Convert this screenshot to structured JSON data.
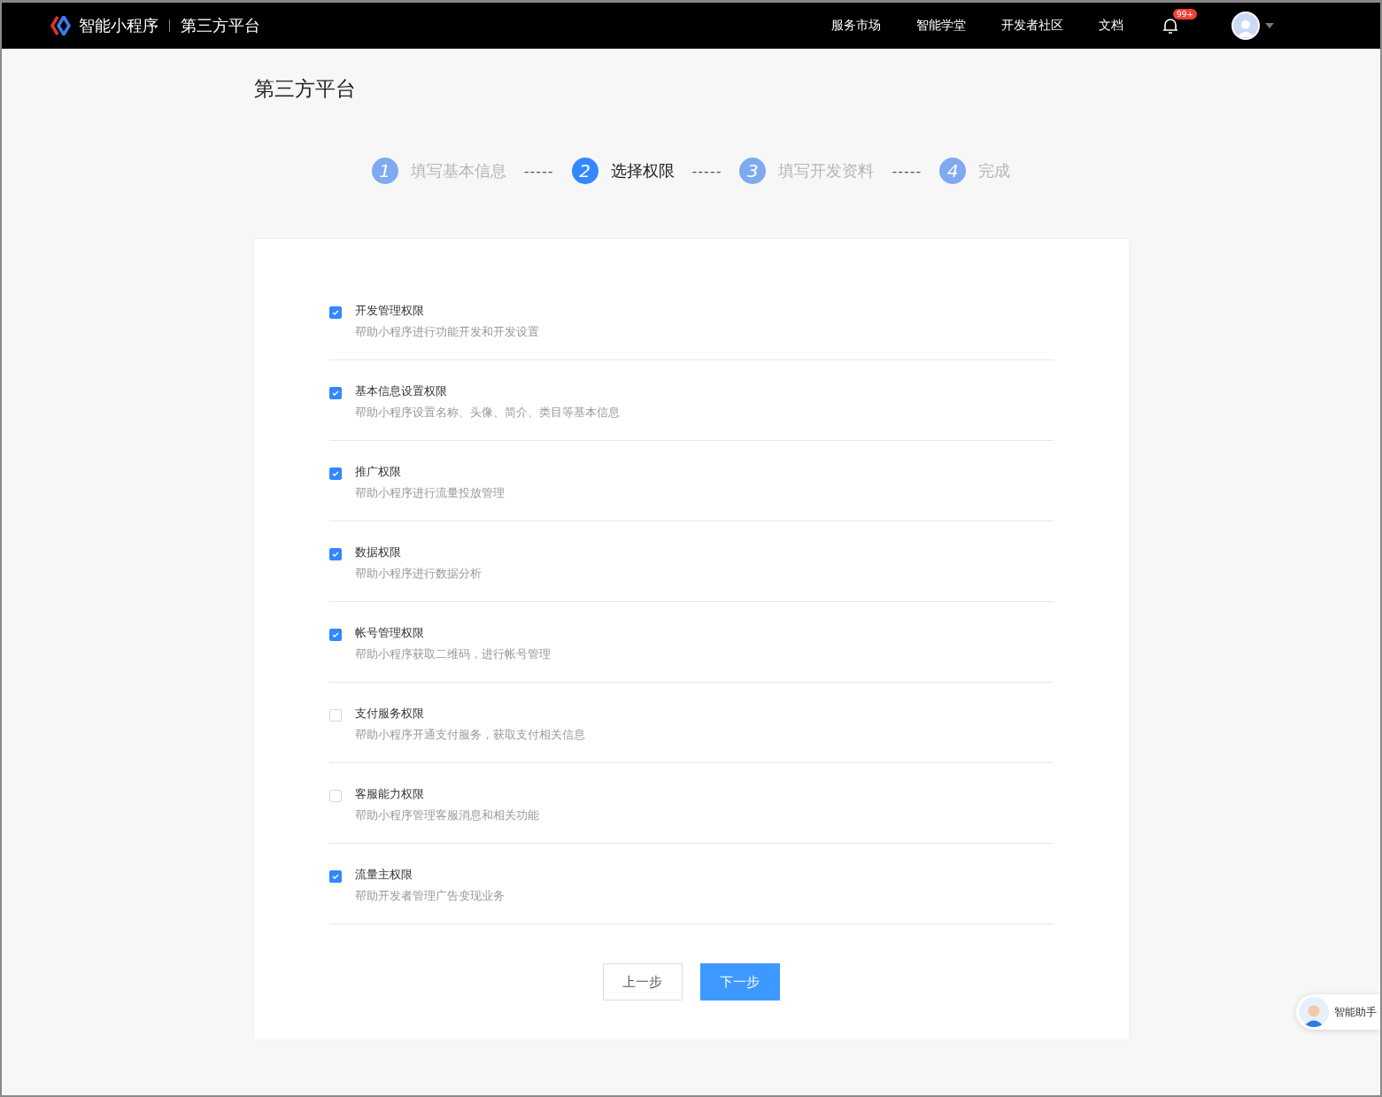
{
  "header": {
    "brand": "智能小程序",
    "section": "第三方平台",
    "nav": [
      "服务市场",
      "智能学堂",
      "开发者社区",
      "文档"
    ],
    "notification_badge": "99+"
  },
  "page_title": "第三方平台",
  "steps": [
    {
      "number": "1",
      "label": "填写基本信息",
      "selected": false,
      "separator": "-----"
    },
    {
      "number": "2",
      "label": "选择权限",
      "selected": true,
      "separator": "-----"
    },
    {
      "number": "3",
      "label": "填写开发资料",
      "selected": false,
      "separator": "-----"
    },
    {
      "number": "4",
      "label": "完成",
      "selected": false
    }
  ],
  "permissions": [
    {
      "title": "开发管理权限",
      "description": "帮助小程序进行功能开发和开发设置",
      "checked": true
    },
    {
      "title": "基本信息设置权限",
      "description": "帮助小程序设置名称、头像、简介、类目等基本信息",
      "checked": true
    },
    {
      "title": "推广权限",
      "description": "帮助小程序进行流量投放管理",
      "checked": true
    },
    {
      "title": "数据权限",
      "description": "帮助小程序进行数据分析",
      "checked": true
    },
    {
      "title": "帐号管理权限",
      "description": "帮助小程序获取二维码，进行帐号管理",
      "checked": true
    },
    {
      "title": "支付服务权限",
      "description": "帮助小程序开通支付服务，获取支付相关信息",
      "checked": false
    },
    {
      "title": "客服能力权限",
      "description": "帮助小程序管理客服消息和相关功能",
      "checked": false
    },
    {
      "title": "流量主权限",
      "description": "帮助开发者管理广告变现业务",
      "checked": true
    }
  ],
  "buttons": [
    {
      "label": "上一步",
      "kind": "secondary"
    },
    {
      "label": "下一步",
      "kind": "primary"
    }
  ],
  "assistant": {
    "label": "智能助手"
  }
}
